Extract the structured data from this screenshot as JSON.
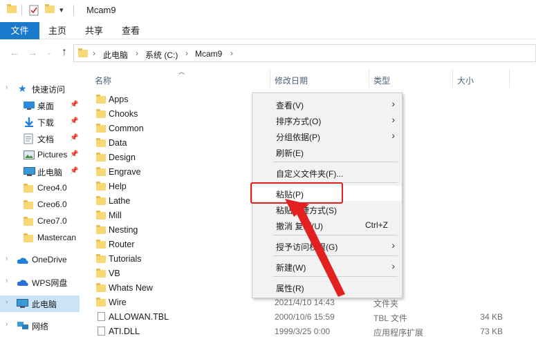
{
  "window": {
    "title": "Mcam9",
    "quick_access_dropdown": "▾"
  },
  "ribbon": {
    "tabs": [
      "文件",
      "主页",
      "共享",
      "查看"
    ]
  },
  "address": {
    "crumbs": [
      "此电脑",
      "系统 (C:)",
      "Mcam9"
    ],
    "separator": "›"
  },
  "nav": {
    "quick_access": "快速访问",
    "items": [
      {
        "label": "桌面",
        "icon": "desktop-icon",
        "pinned": true
      },
      {
        "label": "下载",
        "icon": "download-icon",
        "pinned": true
      },
      {
        "label": "文档",
        "icon": "document-icon",
        "pinned": true
      },
      {
        "label": "Pictures",
        "icon": "pictures-icon",
        "pinned": true
      },
      {
        "label": "此电脑",
        "icon": "computer-icon",
        "pinned": true
      },
      {
        "label": "Creo4.0",
        "icon": "folder-icon",
        "pinned": false
      },
      {
        "label": "Creo6.0",
        "icon": "folder-icon",
        "pinned": false
      },
      {
        "label": "Creo7.0",
        "icon": "folder-icon",
        "pinned": false
      },
      {
        "label": "Mastercan",
        "icon": "folder-icon",
        "pinned": false
      }
    ],
    "onedrive": "OneDrive",
    "wps": "WPS网盘",
    "this_pc": "此电脑",
    "network": "网络"
  },
  "columns": {
    "name": "名称",
    "date": "修改日期",
    "type": "类型",
    "size": "大小"
  },
  "files": [
    {
      "name": "Apps",
      "kind": "folder"
    },
    {
      "name": "Chooks",
      "kind": "folder"
    },
    {
      "name": "Common",
      "kind": "folder"
    },
    {
      "name": "Data",
      "kind": "folder"
    },
    {
      "name": "Design",
      "kind": "folder"
    },
    {
      "name": "Engrave",
      "kind": "folder"
    },
    {
      "name": "Help",
      "kind": "folder"
    },
    {
      "name": "Lathe",
      "kind": "folder"
    },
    {
      "name": "Mill",
      "kind": "folder"
    },
    {
      "name": "Nesting",
      "kind": "folder"
    },
    {
      "name": "Router",
      "kind": "folder"
    },
    {
      "name": "Tutorials",
      "kind": "folder"
    },
    {
      "name": "VB",
      "kind": "folder"
    },
    {
      "name": "Whats New",
      "kind": "folder"
    },
    {
      "name": "Wire",
      "kind": "folder",
      "date": "2021/4/10 14:43",
      "type": "文件夹"
    },
    {
      "name": "ALLOWAN.TBL",
      "kind": "file",
      "date": "2000/10/6 15:59",
      "type": "TBL 文件",
      "size": "34 KB"
    },
    {
      "name": "ATI.DLL",
      "kind": "file",
      "date": "1999/3/25 0:00",
      "type": "应用程序扩展",
      "size": "73 KB"
    }
  ],
  "context_menu": {
    "items": [
      {
        "label": "查看(V)",
        "submenu": true
      },
      {
        "label": "排序方式(O)",
        "submenu": true
      },
      {
        "label": "分组依据(P)",
        "submenu": true
      },
      {
        "label": "刷新(E)",
        "submenu": false
      },
      {
        "label": "自定义文件夹(F)...",
        "submenu": false
      },
      {
        "label": "粘贴(P)",
        "submenu": false
      },
      {
        "label": "粘贴快捷方式(S)",
        "submenu": false
      },
      {
        "label": "撤消 复制(U)",
        "submenu": false,
        "shortcut": "Ctrl+Z"
      },
      {
        "label": "授予访问权限(G)",
        "submenu": true
      },
      {
        "label": "新建(W)",
        "submenu": true
      },
      {
        "label": "属性(R)",
        "submenu": false
      }
    ]
  },
  "colors": {
    "accent": "#1979ca",
    "highlight": "#e32020",
    "folder": "#f8d775"
  }
}
